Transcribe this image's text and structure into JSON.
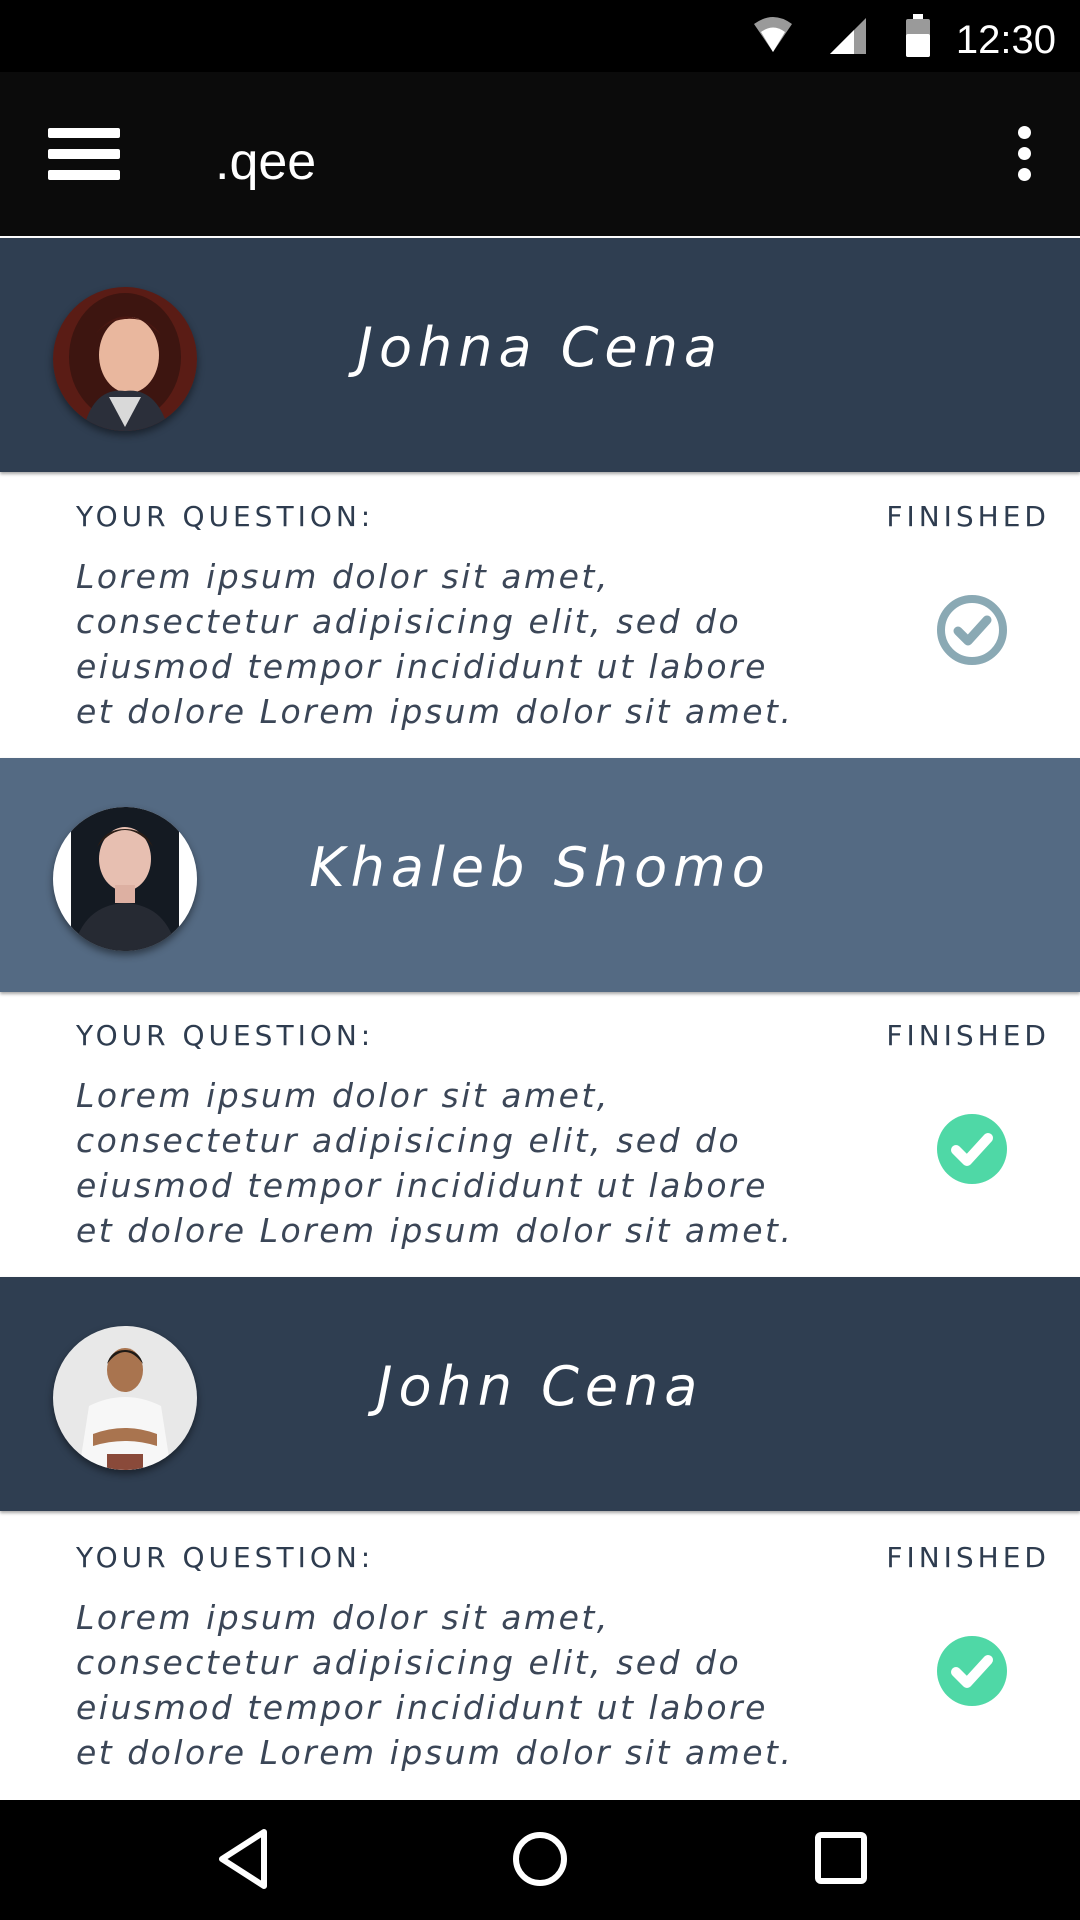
{
  "status_bar": {
    "time": "12:30"
  },
  "app_bar": {
    "title": ".qee"
  },
  "colors": {
    "header_dark": "#2f3e51",
    "header_light": "#546a83",
    "check_pending": "#8aa9b4",
    "check_done": "#4fd8a6",
    "label_text": "#2e3c4f"
  },
  "cards": [
    {
      "name": "Johna Cena",
      "question_label": "YOUR QUESTION:",
      "status_label": "FINISHED",
      "question_lines": [
        "Lorem ipsum dolor sit amet,",
        "consectetur adipisicing elit, sed do",
        "eiusmod tempor incididunt ut labore",
        "et dolore Lorem ipsum dolor sit amet."
      ],
      "check_state": "outline"
    },
    {
      "name": "Khaleb Shomo",
      "question_label": "YOUR QUESTION:",
      "status_label": "FINISHED",
      "question_lines": [
        "Lorem ipsum dolor sit amet,",
        "consectetur adipisicing elit, sed do",
        "eiusmod tempor incididunt ut labore",
        "et dolore Lorem ipsum dolor sit amet."
      ],
      "check_state": "filled"
    },
    {
      "name": "John Cena",
      "question_label": "YOUR QUESTION:",
      "status_label": "FINISHED",
      "question_lines": [
        "Lorem ipsum dolor sit amet,",
        "consectetur adipisicing elit, sed do",
        "eiusmod tempor incididunt ut labore",
        "et dolore Lorem ipsum dolor sit amet."
      ],
      "check_state": "filled"
    }
  ],
  "nav_bar": {
    "icons": [
      "back-icon",
      "home-icon",
      "recents-icon"
    ]
  }
}
